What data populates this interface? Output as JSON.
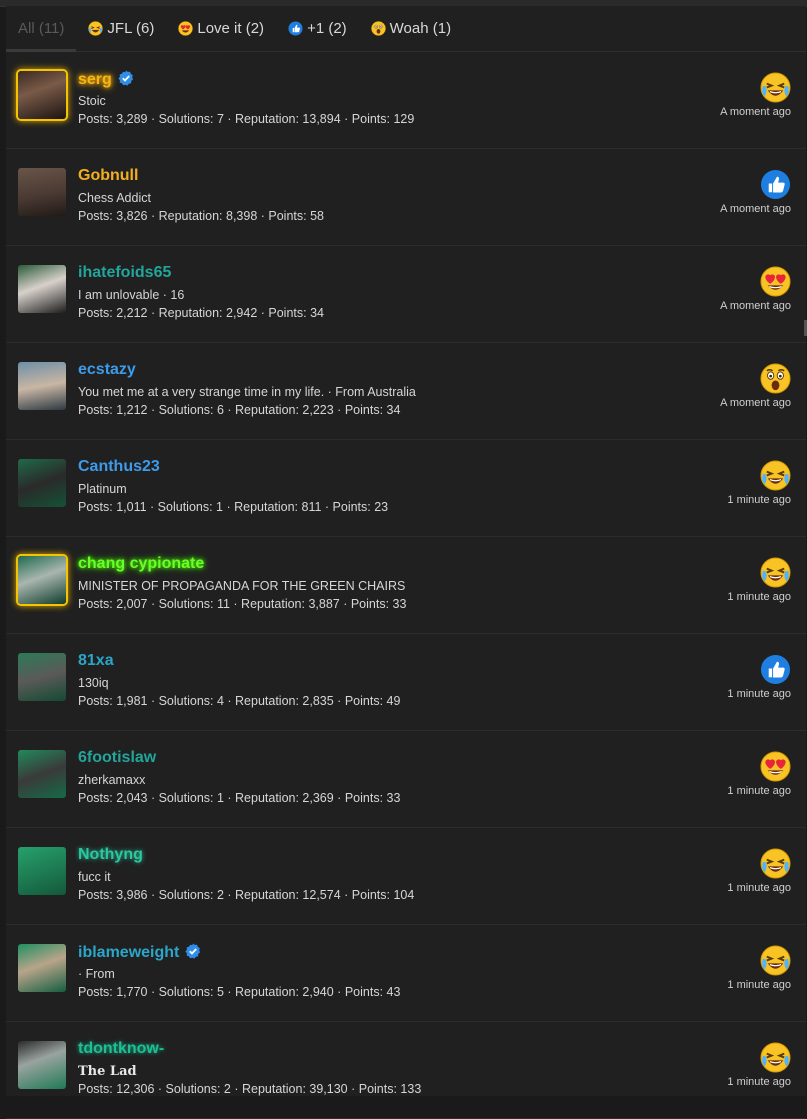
{
  "tabs": [
    {
      "label": "All (11)",
      "active": true,
      "icon": ""
    },
    {
      "label": "JFL (6)",
      "icon": "jfl-laugh-icon"
    },
    {
      "label": "Love it (2)",
      "icon": "heart-eyes-icon"
    },
    {
      "label": "+1 (2)",
      "icon": "thumbs-up-icon"
    },
    {
      "label": "Woah (1)",
      "icon": "woah-icon"
    }
  ],
  "rows": [
    {
      "name": "serg",
      "verified": true,
      "title": "Stoic",
      "stats": "Posts: 3,289 · Solutions: 7 · Reputation: 13,894 · Points: 129",
      "reaction": "jfl-laugh-icon",
      "time": "A moment ago",
      "name_color": "#f2b617",
      "avatar_frame": "gold"
    },
    {
      "name": "Gobnull",
      "verified": false,
      "title": "Chess Addict",
      "stats": "Posts: 3,826 · Reputation: 8,398 · Points: 58",
      "reaction": "thumbs-up-icon",
      "time": "A moment ago",
      "name_color": "#f2b01e"
    },
    {
      "name": "ihatefoids65",
      "verified": false,
      "title": "I am unlovable · 16",
      "stats": "Posts: 2,212 · Reputation: 2,942 · Points: 34",
      "reaction": "heart-eyes-icon",
      "time": "A moment ago",
      "name_color": "#22a59a"
    },
    {
      "name": "ecstazy",
      "verified": false,
      "title": "You met me at a very strange time in my life. · From Australia",
      "stats": "Posts: 1,212 · Solutions: 6 · Reputation: 2,223 · Points: 34",
      "reaction": "woah-icon",
      "time": "A moment ago",
      "name_color": "#3d9bea"
    },
    {
      "name": "Canthus23",
      "verified": false,
      "title": "Platinum",
      "stats": "Posts: 1,011 · Solutions: 1 · Reputation: 811 · Points: 23",
      "reaction": "jfl-laugh-icon",
      "time": "1 minute ago",
      "name_color": "#3d9bea"
    },
    {
      "name": "chang cypionate",
      "verified": false,
      "title": "MINISTER OF PROPAGANDA FOR THE GREEN CHAIRS",
      "stats": "Posts: 2,007 · Solutions: 11 · Reputation: 3,887 · Points: 33",
      "reaction": "jfl-laugh-icon",
      "time": "1 minute ago",
      "name_color": "#67ff2a",
      "avatar_frame": "gold"
    },
    {
      "name": "81xa",
      "verified": false,
      "title": "130iq",
      "stats": "Posts: 1,981 · Solutions: 4 · Reputation: 2,835 · Points: 49",
      "reaction": "thumbs-up-icon",
      "time": "1 minute ago",
      "name_color": "#2aa6c9"
    },
    {
      "name": "6footislaw",
      "verified": false,
      "title": "zherkamaxx",
      "stats": "Posts: 2,043 · Solutions: 1 · Reputation: 2,369 · Points: 33",
      "reaction": "heart-eyes-icon",
      "time": "1 minute ago",
      "name_color": "#22a59a"
    },
    {
      "name": "Nothyng",
      "verified": false,
      "title": "fucc it",
      "stats": "Posts: 3,986 · Solutions: 2 · Reputation: 12,574 · Points: 104",
      "reaction": "jfl-laugh-icon",
      "time": "1 minute ago",
      "name_color": "#2ec5a0"
    },
    {
      "name": "iblameweight",
      "verified": true,
      "title": " · From",
      "stats": "Posts: 1,770 · Solutions: 5 · Reputation: 2,940 · Points: 43",
      "reaction": "jfl-laugh-icon",
      "time": "1 minute ago",
      "name_color": "#2aa6c9"
    },
    {
      "name": "tdontknow-",
      "verified": false,
      "title": "The Lad",
      "stats": "Posts: 12,306 · Solutions: 2 · Reputation: 39,130 · Points: 133",
      "reaction": "jfl-laugh-icon",
      "time": "1 minute ago",
      "name_color": "#1fbf93"
    }
  ]
}
